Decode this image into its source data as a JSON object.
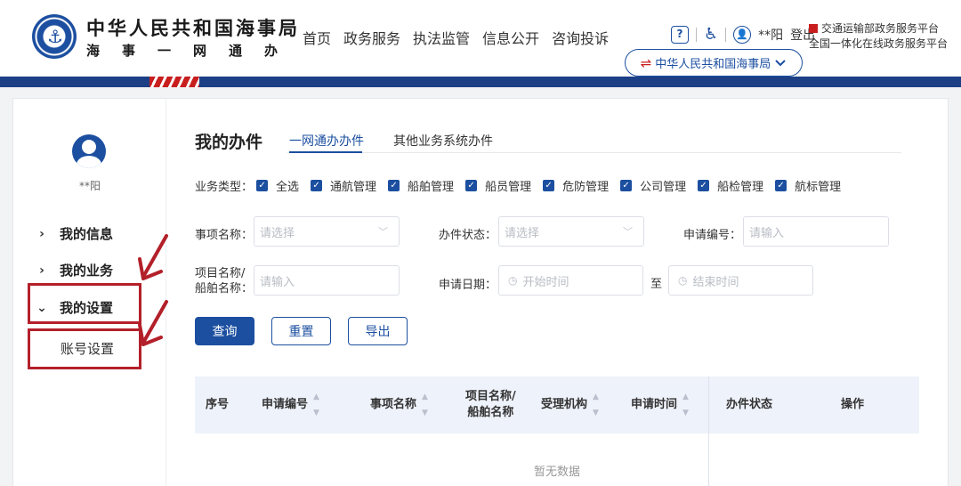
{
  "header": {
    "org_title": "中华人民共和国海事局",
    "org_subtitle": "海事一网通办",
    "nav": [
      "首页",
      "政务服务",
      "执法监管",
      "信息公开",
      "咨询投诉"
    ],
    "user": "**阳",
    "logout": "登出",
    "platform_line1": "交通运输部政务服务平台",
    "platform_line2": "全国一体化在线政务服务平台",
    "org_select": "中华人民共和国海事局",
    "help_icon_text": "?"
  },
  "sidebar": {
    "user": "**阳",
    "items": [
      {
        "label": "我的信息",
        "expanded": false
      },
      {
        "label": "我的业务",
        "expanded": false
      },
      {
        "label": "我的设置",
        "expanded": true
      }
    ],
    "sub_item": "账号设置"
  },
  "main": {
    "title": "我的办件",
    "tabs": [
      {
        "label": "一网通办办件",
        "active": true
      },
      {
        "label": "其他业务系统办件",
        "active": false
      }
    ],
    "business_type_label": "业务类型：",
    "business_types": [
      "全选",
      "通航管理",
      "船舶管理",
      "船员管理",
      "危防管理",
      "公司管理",
      "船检管理",
      "航标管理"
    ],
    "filters": {
      "item_name_label": "事项名称：",
      "item_name_placeholder": "请选择",
      "status_label": "办件状态：",
      "status_placeholder": "请选择",
      "apply_no_label": "申请编号：",
      "apply_no_placeholder": "请输入",
      "project_label_1": "项目名称/",
      "project_label_2": "船舶名称：",
      "project_placeholder": "请输入",
      "date_label": "申请日期：",
      "date_start": "开始时间",
      "date_to": "至",
      "date_end": "结束时间"
    },
    "buttons": {
      "query": "查询",
      "reset": "重置",
      "export": "导出"
    },
    "table": {
      "columns": [
        "序号",
        "申请编号",
        "事项名称",
        "项目名称/",
        "船舶名称",
        "受理机构",
        "申请时间",
        "办件状态",
        "操作"
      ],
      "empty_text": "暂无数据"
    }
  },
  "colors": {
    "brand": "#1c4fa0",
    "highlight": "#b3202a",
    "platform_red": "#c81e1e"
  }
}
